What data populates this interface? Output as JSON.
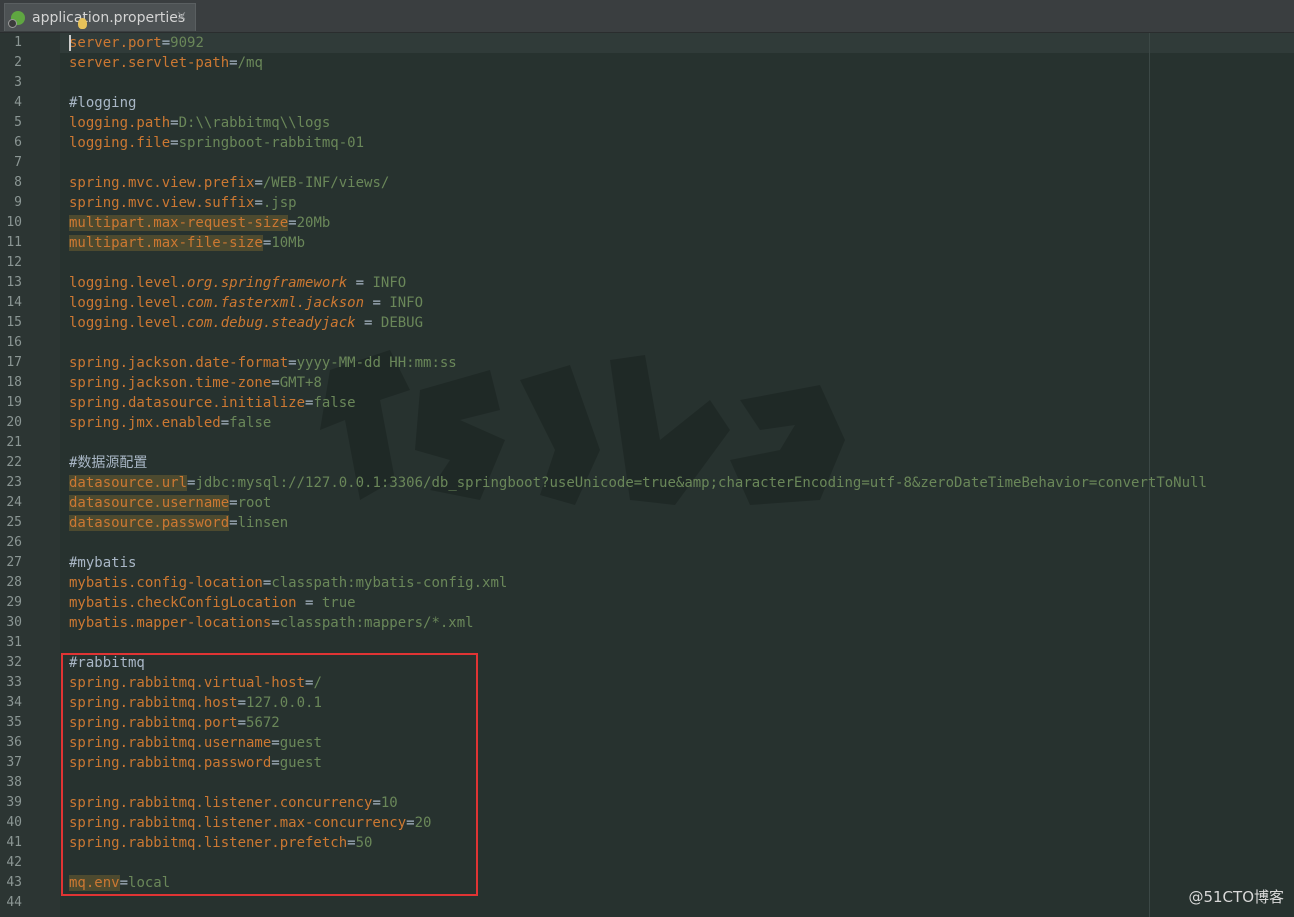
{
  "tab": {
    "label": "application.properties",
    "close": "×",
    "icon": "spring-properties-icon"
  },
  "footer": {
    "watermark": "@51CTO博客"
  },
  "colors": {
    "key": "#cc7832",
    "value": "#6a8759",
    "highlight_box": "#e03434",
    "background": "#27322f"
  },
  "lines": [
    {
      "n": "1",
      "k": "server.port",
      "s": "=",
      "v": "9092"
    },
    {
      "n": "2",
      "k": "server.servlet-path",
      "s": "=",
      "v": "/mq"
    },
    {
      "n": "3"
    },
    {
      "n": "4",
      "c": "#logging"
    },
    {
      "n": "5",
      "k": "logging.path",
      "s": "=",
      "v": "D:\\\\rabbitmq\\\\logs"
    },
    {
      "n": "6",
      "k": "logging.file",
      "s": "=",
      "v": "springboot-rabbitmq-01"
    },
    {
      "n": "7"
    },
    {
      "n": "8",
      "k": "spring.mvc.view.prefix",
      "s": "=",
      "v": "/WEB-INF/views/"
    },
    {
      "n": "9",
      "k": "spring.mvc.view.suffix",
      "s": "=",
      "v": ".jsp"
    },
    {
      "n": "10",
      "k": "multipart.max-request-size",
      "s": "=",
      "v": "20Mb",
      "h": true
    },
    {
      "n": "11",
      "k": "multipart.max-file-size",
      "s": "=",
      "v": "10Mb",
      "h": true
    },
    {
      "n": "12"
    },
    {
      "n": "13",
      "k": "logging.level.",
      "ki": "org.springframework",
      "s": " = ",
      "v": "INFO"
    },
    {
      "n": "14",
      "k": "logging.level.",
      "ki": "com.fasterxml.jackson",
      "s": " = ",
      "v": "INFO"
    },
    {
      "n": "15",
      "k": "logging.level.",
      "ki": "com.debug.steadyjack",
      "s": " = ",
      "v": "DEBUG"
    },
    {
      "n": "16"
    },
    {
      "n": "17",
      "k": "spring.jackson.date-format",
      "s": "=",
      "v": "yyyy-MM-dd HH:mm:ss"
    },
    {
      "n": "18",
      "k": "spring.jackson.time-zone",
      "s": "=",
      "v": "GMT+8"
    },
    {
      "n": "19",
      "k": "spring.datasource.initialize",
      "s": "=",
      "v": "false"
    },
    {
      "n": "20",
      "k": "spring.jmx.enabled",
      "s": "=",
      "v": "false"
    },
    {
      "n": "21"
    },
    {
      "n": "22",
      "c": "#数据源配置"
    },
    {
      "n": "23",
      "k": "datasource.url",
      "s": "=",
      "v": "jdbc:mysql://127.0.0.1:3306/db_springboot?useUnicode=true&amp;characterEncoding=utf-8&zeroDateTimeBehavior=convertToNull",
      "h": true
    },
    {
      "n": "24",
      "k": "datasource.username",
      "s": "=",
      "v": "root",
      "h": true
    },
    {
      "n": "25",
      "k": "datasource.password",
      "s": "=",
      "v": "linsen",
      "h": true
    },
    {
      "n": "26"
    },
    {
      "n": "27",
      "c": "#mybatis"
    },
    {
      "n": "28",
      "k": "mybatis.config-location",
      "s": "=",
      "v": "classpath:mybatis-config.xml"
    },
    {
      "n": "29",
      "k": "mybatis.checkConfigLocation",
      "s": " = ",
      "v": "true"
    },
    {
      "n": "30",
      "k": "mybatis.mapper-locations",
      "s": "=",
      "v": "classpath:mappers/*.xml"
    },
    {
      "n": "31"
    },
    {
      "n": "32",
      "c": "#rabbitmq"
    },
    {
      "n": "33",
      "k": "spring.rabbitmq.virtual-host",
      "s": "=",
      "v": "/"
    },
    {
      "n": "34",
      "k": "spring.rabbitmq.host",
      "s": "=",
      "v": "127.0.0.1"
    },
    {
      "n": "35",
      "k": "spring.rabbitmq.port",
      "s": "=",
      "v": "5672"
    },
    {
      "n": "36",
      "k": "spring.rabbitmq.username",
      "s": "=",
      "v": "guest"
    },
    {
      "n": "37",
      "k": "spring.rabbitmq.password",
      "s": "=",
      "v": "guest"
    },
    {
      "n": "38"
    },
    {
      "n": "39",
      "k": "spring.rabbitmq.listener.concurrency",
      "s": "=",
      "v": "10"
    },
    {
      "n": "40",
      "k": "spring.rabbitmq.listener.max-concurrency",
      "s": "=",
      "v": "20"
    },
    {
      "n": "41",
      "k": "spring.rabbitmq.listener.prefetch",
      "s": "=",
      "v": "50"
    },
    {
      "n": "42"
    },
    {
      "n": "43",
      "k": "mq.env",
      "s": "=",
      "v": "local",
      "h": true
    },
    {
      "n": "44"
    }
  ]
}
